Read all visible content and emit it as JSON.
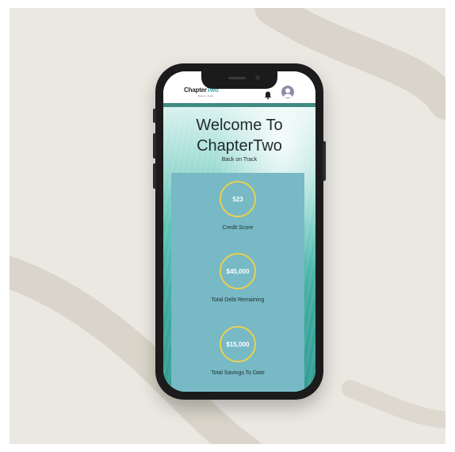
{
  "app": {
    "brand": {
      "name_part1": "Chapter",
      "name_part2": "Two",
      "tagline": "Back on Track"
    },
    "icons": {
      "notifications": "bell-icon",
      "profile": "user-avatar-icon"
    }
  },
  "hero": {
    "title_line1": "Welcome To",
    "title_line2": "ChapterTwo",
    "subtitle": "Back on Track"
  },
  "stats": [
    {
      "value": "523",
      "label": "Credit Score"
    },
    {
      "value": "$45,000",
      "label": "Total Debt Remaining"
    },
    {
      "value": "$15,000",
      "label": "Total Savings To Date"
    }
  ],
  "colors": {
    "accent": "#38a9a6",
    "bar": "#3f8b82",
    "panel": "#77b9c4",
    "ring": "#e9cf52",
    "background": "#ebe8e2"
  }
}
